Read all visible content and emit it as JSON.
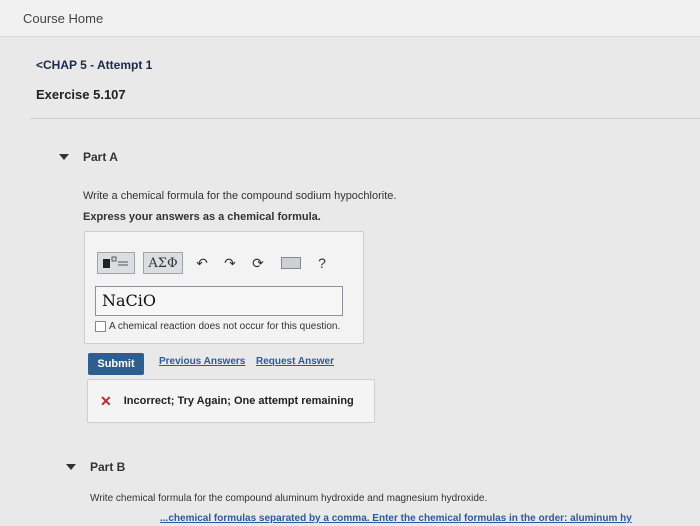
{
  "nav": {
    "course_home": "Course Home",
    "chapter_link": "<CHAP 5 - Attempt 1",
    "exercise_title": "Exercise 5.107"
  },
  "partA": {
    "label": "Part A",
    "question": "Write a chemical formula for the compound sodium hypochlorite.",
    "instruction": "Express your answers as a chemical formula.",
    "toolbar": {
      "greek_label": "ΑΣΦ",
      "help_label": "?"
    },
    "answer_value": "NaCiO",
    "no_reaction_label": "A chemical reaction does not occur for this question.",
    "submit_label": "Submit",
    "previous_answers_label": "Previous Answers",
    "request_answer_label": "Request Answer",
    "feedback_text": "Incorrect; Try Again; One attempt remaining"
  },
  "partB": {
    "label": "Part B",
    "question": "Write chemical formula for the compound aluminum hydroxide and magnesium hydroxide.",
    "instruction_partial": "...chemical formulas separated by a comma. Enter the chemical formulas in the order: aluminum hy"
  },
  "colors": {
    "background": "#e9e9ea",
    "submit_blue": "#2e5d8f",
    "link_blue": "#2a5b9a",
    "error_red": "#c0262c"
  }
}
